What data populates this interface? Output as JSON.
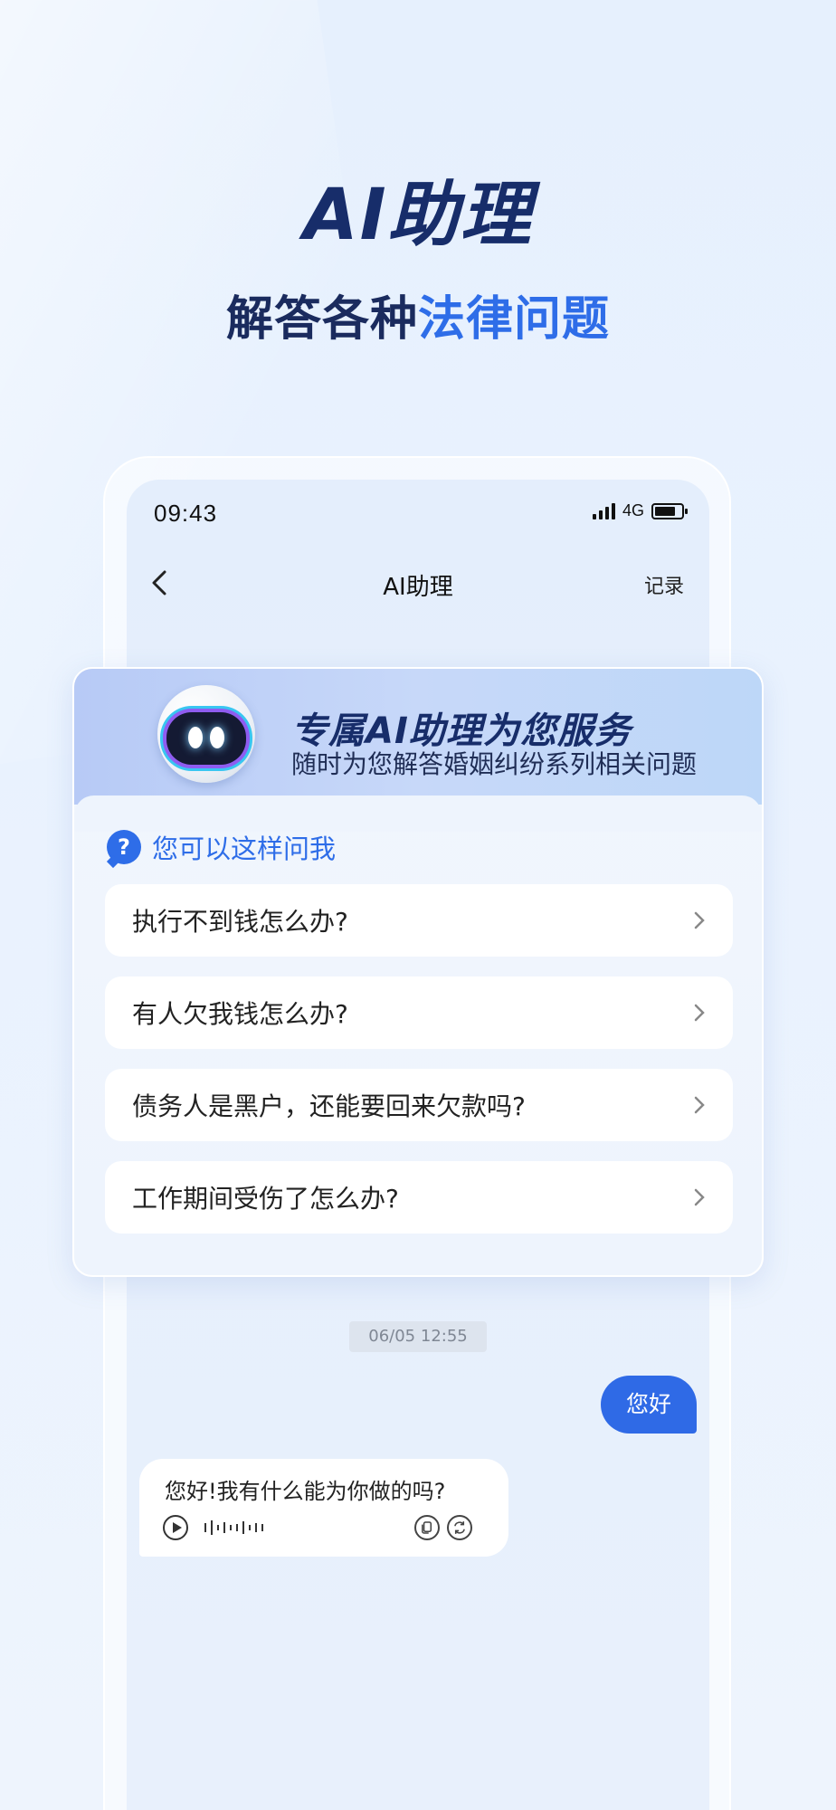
{
  "hero": {
    "title": "AI助理",
    "subtitle_part1": "解答各种",
    "subtitle_part2": "法律问题"
  },
  "status_bar": {
    "time": "09:43",
    "network": "4G"
  },
  "nav": {
    "title": "AI助理",
    "record_label": "记录"
  },
  "card": {
    "title": "专属AI助理为您服务",
    "subtitle": "随时为您解答婚姻纠纷系列相关问题",
    "ask_label": "您可以这样问我",
    "questions": [
      "执行不到钱怎么办?",
      "有人欠我钱怎么办?",
      "债务人是黑户，还能要回来欠款吗?",
      "工作期间受伤了怎么办?"
    ]
  },
  "chat": {
    "timestamp": "06/05 12:55",
    "user_message": "您好",
    "bot_message": "您好!我有什么能为你做的吗?"
  },
  "colors": {
    "accent": "#2e6de8",
    "title_navy": "#172d6a",
    "user_bubble": "#2f6ae6"
  }
}
